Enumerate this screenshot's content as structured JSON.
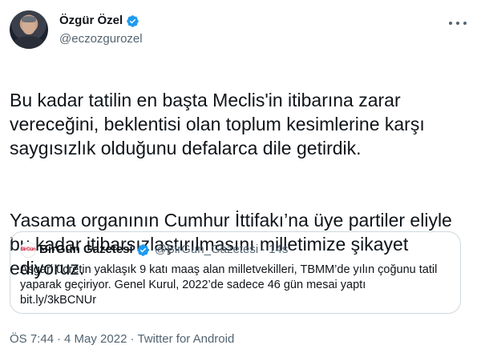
{
  "author": {
    "display_name": "Özgür Özel",
    "handle": "@eczozgurozel",
    "verified": true
  },
  "tweet": {
    "paragraph_1": "Bu kadar tatilin en başta Meclis'in itibarına zarar\nvereceğini, beklentisi olan toplum kesimlerine karşı\nsaygısızlık olduğunu defalarca dile getirdik.",
    "paragraph_2": "Yasama organının Cumhur İttifakı’na üye partiler eliyle\nbu kadar itibarsızlaştırılmasını milletimize şikayet\nediyoruz."
  },
  "quoted_tweet": {
    "avatar_text": "BirGün",
    "display_name": "BirGün Gazetesi",
    "handle": "@BirGun_Gazetesi",
    "separator": "·",
    "time": "14s",
    "body": "Asgari ücretin yaklaşık 9 katı maaş alan milletvekilleri, TBMM’de yılın çoğunu tatil\nyaparak geçiriyor. Genel Kurul, 2022’de sadece 46 gün mesai yaptı\nbit.ly/3kBCNUr"
  },
  "footer": {
    "time": "ÖS 7:44",
    "separator": "·",
    "date": "4 May 2022",
    "source": "Twitter for Android"
  },
  "colors": {
    "verified": "#1d9bf0",
    "secondary_text": "#536471",
    "border": "#cfd9de"
  }
}
